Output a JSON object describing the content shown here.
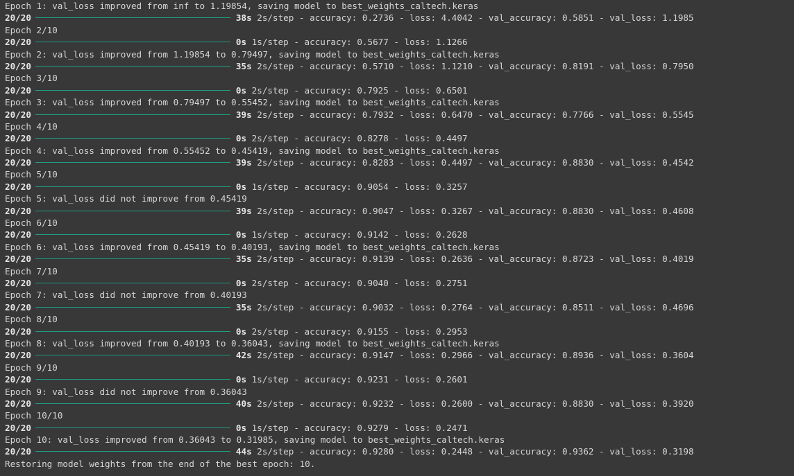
{
  "lines": [
    {
      "kind": "text",
      "text": "Epoch 1: val_loss improved from inf to 1.19854, saving model to best_weights_caltech.keras"
    },
    {
      "kind": "progress",
      "step": "20/20",
      "time": "38s",
      "rest": " 2s/step - accuracy: 0.2736 - loss: 4.4042 - val_accuracy: 0.5851 - val_loss: 1.1985"
    },
    {
      "kind": "text",
      "text": "Epoch 2/10"
    },
    {
      "kind": "progress",
      "step": "20/20",
      "time": "0s",
      "rest": " 1s/step - accuracy: 0.5677 - loss: 1.1266"
    },
    {
      "kind": "text",
      "text": "Epoch 2: val_loss improved from 1.19854 to 0.79497, saving model to best_weights_caltech.keras"
    },
    {
      "kind": "progress",
      "step": "20/20",
      "time": "35s",
      "rest": " 2s/step - accuracy: 0.5710 - loss: 1.1210 - val_accuracy: 0.8191 - val_loss: 0.7950"
    },
    {
      "kind": "text",
      "text": "Epoch 3/10"
    },
    {
      "kind": "progress",
      "step": "20/20",
      "time": "0s",
      "rest": " 2s/step - accuracy: 0.7925 - loss: 0.6501"
    },
    {
      "kind": "text",
      "text": "Epoch 3: val_loss improved from 0.79497 to 0.55452, saving model to best_weights_caltech.keras"
    },
    {
      "kind": "progress",
      "step": "20/20",
      "time": "39s",
      "rest": " 2s/step - accuracy: 0.7932 - loss: 0.6470 - val_accuracy: 0.7766 - val_loss: 0.5545"
    },
    {
      "kind": "text",
      "text": "Epoch 4/10"
    },
    {
      "kind": "progress",
      "step": "20/20",
      "time": "0s",
      "rest": " 2s/step - accuracy: 0.8278 - loss: 0.4497"
    },
    {
      "kind": "text",
      "text": "Epoch 4: val_loss improved from 0.55452 to 0.45419, saving model to best_weights_caltech.keras"
    },
    {
      "kind": "progress",
      "step": "20/20",
      "time": "39s",
      "rest": " 2s/step - accuracy: 0.8283 - loss: 0.4497 - val_accuracy: 0.8830 - val_loss: 0.4542"
    },
    {
      "kind": "text",
      "text": "Epoch 5/10"
    },
    {
      "kind": "progress",
      "step": "20/20",
      "time": "0s",
      "rest": " 1s/step - accuracy: 0.9054 - loss: 0.3257"
    },
    {
      "kind": "text",
      "text": "Epoch 5: val_loss did not improve from 0.45419"
    },
    {
      "kind": "progress",
      "step": "20/20",
      "time": "39s",
      "rest": " 2s/step - accuracy: 0.9047 - loss: 0.3267 - val_accuracy: 0.8830 - val_loss: 0.4608"
    },
    {
      "kind": "text",
      "text": "Epoch 6/10"
    },
    {
      "kind": "progress",
      "step": "20/20",
      "time": "0s",
      "rest": " 1s/step - accuracy: 0.9142 - loss: 0.2628"
    },
    {
      "kind": "text",
      "text": "Epoch 6: val_loss improved from 0.45419 to 0.40193, saving model to best_weights_caltech.keras"
    },
    {
      "kind": "progress",
      "step": "20/20",
      "time": "35s",
      "rest": " 2s/step - accuracy: 0.9139 - loss: 0.2636 - val_accuracy: 0.8723 - val_loss: 0.4019"
    },
    {
      "kind": "text",
      "text": "Epoch 7/10"
    },
    {
      "kind": "progress",
      "step": "20/20",
      "time": "0s",
      "rest": " 2s/step - accuracy: 0.9040 - loss: 0.2751"
    },
    {
      "kind": "text",
      "text": "Epoch 7: val_loss did not improve from 0.40193"
    },
    {
      "kind": "progress",
      "step": "20/20",
      "time": "35s",
      "rest": " 2s/step - accuracy: 0.9032 - loss: 0.2764 - val_accuracy: 0.8511 - val_loss: 0.4696"
    },
    {
      "kind": "text",
      "text": "Epoch 8/10"
    },
    {
      "kind": "progress",
      "step": "20/20",
      "time": "0s",
      "rest": " 2s/step - accuracy: 0.9155 - loss: 0.2953"
    },
    {
      "kind": "text",
      "text": "Epoch 8: val_loss improved from 0.40193 to 0.36043, saving model to best_weights_caltech.keras"
    },
    {
      "kind": "progress",
      "step": "20/20",
      "time": "42s",
      "rest": " 2s/step - accuracy: 0.9147 - loss: 0.2966 - val_accuracy: 0.8936 - val_loss: 0.3604"
    },
    {
      "kind": "text",
      "text": "Epoch 9/10"
    },
    {
      "kind": "progress",
      "step": "20/20",
      "time": "0s",
      "rest": " 1s/step - accuracy: 0.9231 - loss: 0.2601"
    },
    {
      "kind": "text",
      "text": "Epoch 9: val_loss did not improve from 0.36043"
    },
    {
      "kind": "progress",
      "step": "20/20",
      "time": "40s",
      "rest": " 2s/step - accuracy: 0.9232 - loss: 0.2600 - val_accuracy: 0.8830 - val_loss: 0.3920"
    },
    {
      "kind": "text",
      "text": "Epoch 10/10"
    },
    {
      "kind": "progress",
      "step": "20/20",
      "time": "0s",
      "rest": " 1s/step - accuracy: 0.9279 - loss: 0.2471"
    },
    {
      "kind": "text",
      "text": "Epoch 10: val_loss improved from 0.36043 to 0.31985, saving model to best_weights_caltech.keras"
    },
    {
      "kind": "progress",
      "step": "20/20",
      "time": "44s",
      "rest": " 2s/step - accuracy: 0.9280 - loss: 0.2448 - val_accuracy: 0.9362 - val_loss: 0.3198"
    },
    {
      "kind": "text",
      "text": "Restoring model weights from the end of the best epoch: 10."
    }
  ],
  "colors": {
    "background": "#383838",
    "text": "#d5d5d5",
    "progress_bar": "#1e9e84"
  }
}
